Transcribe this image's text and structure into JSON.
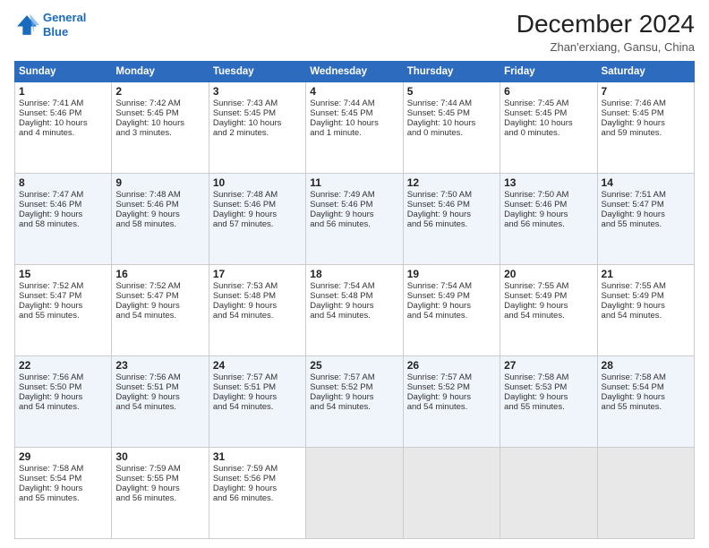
{
  "logo": {
    "line1": "General",
    "line2": "Blue"
  },
  "title": "December 2024",
  "subtitle": "Zhan'erxiang, Gansu, China",
  "days_header": [
    "Sunday",
    "Monday",
    "Tuesday",
    "Wednesday",
    "Thursday",
    "Friday",
    "Saturday"
  ],
  "weeks": [
    [
      {
        "day": "1",
        "lines": [
          "Sunrise: 7:41 AM",
          "Sunset: 5:46 PM",
          "Daylight: 10 hours",
          "and 4 minutes."
        ]
      },
      {
        "day": "2",
        "lines": [
          "Sunrise: 7:42 AM",
          "Sunset: 5:45 PM",
          "Daylight: 10 hours",
          "and 3 minutes."
        ]
      },
      {
        "day": "3",
        "lines": [
          "Sunrise: 7:43 AM",
          "Sunset: 5:45 PM",
          "Daylight: 10 hours",
          "and 2 minutes."
        ]
      },
      {
        "day": "4",
        "lines": [
          "Sunrise: 7:44 AM",
          "Sunset: 5:45 PM",
          "Daylight: 10 hours",
          "and 1 minute."
        ]
      },
      {
        "day": "5",
        "lines": [
          "Sunrise: 7:44 AM",
          "Sunset: 5:45 PM",
          "Daylight: 10 hours",
          "and 0 minutes."
        ]
      },
      {
        "day": "6",
        "lines": [
          "Sunrise: 7:45 AM",
          "Sunset: 5:45 PM",
          "Daylight: 10 hours",
          "and 0 minutes."
        ]
      },
      {
        "day": "7",
        "lines": [
          "Sunrise: 7:46 AM",
          "Sunset: 5:45 PM",
          "Daylight: 9 hours",
          "and 59 minutes."
        ]
      }
    ],
    [
      {
        "day": "8",
        "lines": [
          "Sunrise: 7:47 AM",
          "Sunset: 5:46 PM",
          "Daylight: 9 hours",
          "and 58 minutes."
        ]
      },
      {
        "day": "9",
        "lines": [
          "Sunrise: 7:48 AM",
          "Sunset: 5:46 PM",
          "Daylight: 9 hours",
          "and 58 minutes."
        ]
      },
      {
        "day": "10",
        "lines": [
          "Sunrise: 7:48 AM",
          "Sunset: 5:46 PM",
          "Daylight: 9 hours",
          "and 57 minutes."
        ]
      },
      {
        "day": "11",
        "lines": [
          "Sunrise: 7:49 AM",
          "Sunset: 5:46 PM",
          "Daylight: 9 hours",
          "and 56 minutes."
        ]
      },
      {
        "day": "12",
        "lines": [
          "Sunrise: 7:50 AM",
          "Sunset: 5:46 PM",
          "Daylight: 9 hours",
          "and 56 minutes."
        ]
      },
      {
        "day": "13",
        "lines": [
          "Sunrise: 7:50 AM",
          "Sunset: 5:46 PM",
          "Daylight: 9 hours",
          "and 56 minutes."
        ]
      },
      {
        "day": "14",
        "lines": [
          "Sunrise: 7:51 AM",
          "Sunset: 5:47 PM",
          "Daylight: 9 hours",
          "and 55 minutes."
        ]
      }
    ],
    [
      {
        "day": "15",
        "lines": [
          "Sunrise: 7:52 AM",
          "Sunset: 5:47 PM",
          "Daylight: 9 hours",
          "and 55 minutes."
        ]
      },
      {
        "day": "16",
        "lines": [
          "Sunrise: 7:52 AM",
          "Sunset: 5:47 PM",
          "Daylight: 9 hours",
          "and 54 minutes."
        ]
      },
      {
        "day": "17",
        "lines": [
          "Sunrise: 7:53 AM",
          "Sunset: 5:48 PM",
          "Daylight: 9 hours",
          "and 54 minutes."
        ]
      },
      {
        "day": "18",
        "lines": [
          "Sunrise: 7:54 AM",
          "Sunset: 5:48 PM",
          "Daylight: 9 hours",
          "and 54 minutes."
        ]
      },
      {
        "day": "19",
        "lines": [
          "Sunrise: 7:54 AM",
          "Sunset: 5:49 PM",
          "Daylight: 9 hours",
          "and 54 minutes."
        ]
      },
      {
        "day": "20",
        "lines": [
          "Sunrise: 7:55 AM",
          "Sunset: 5:49 PM",
          "Daylight: 9 hours",
          "and 54 minutes."
        ]
      },
      {
        "day": "21",
        "lines": [
          "Sunrise: 7:55 AM",
          "Sunset: 5:49 PM",
          "Daylight: 9 hours",
          "and 54 minutes."
        ]
      }
    ],
    [
      {
        "day": "22",
        "lines": [
          "Sunrise: 7:56 AM",
          "Sunset: 5:50 PM",
          "Daylight: 9 hours",
          "and 54 minutes."
        ]
      },
      {
        "day": "23",
        "lines": [
          "Sunrise: 7:56 AM",
          "Sunset: 5:51 PM",
          "Daylight: 9 hours",
          "and 54 minutes."
        ]
      },
      {
        "day": "24",
        "lines": [
          "Sunrise: 7:57 AM",
          "Sunset: 5:51 PM",
          "Daylight: 9 hours",
          "and 54 minutes."
        ]
      },
      {
        "day": "25",
        "lines": [
          "Sunrise: 7:57 AM",
          "Sunset: 5:52 PM",
          "Daylight: 9 hours",
          "and 54 minutes."
        ]
      },
      {
        "day": "26",
        "lines": [
          "Sunrise: 7:57 AM",
          "Sunset: 5:52 PM",
          "Daylight: 9 hours",
          "and 54 minutes."
        ]
      },
      {
        "day": "27",
        "lines": [
          "Sunrise: 7:58 AM",
          "Sunset: 5:53 PM",
          "Daylight: 9 hours",
          "and 55 minutes."
        ]
      },
      {
        "day": "28",
        "lines": [
          "Sunrise: 7:58 AM",
          "Sunset: 5:54 PM",
          "Daylight: 9 hours",
          "and 55 minutes."
        ]
      }
    ],
    [
      {
        "day": "29",
        "lines": [
          "Sunrise: 7:58 AM",
          "Sunset: 5:54 PM",
          "Daylight: 9 hours",
          "and 55 minutes."
        ]
      },
      {
        "day": "30",
        "lines": [
          "Sunrise: 7:59 AM",
          "Sunset: 5:55 PM",
          "Daylight: 9 hours",
          "and 56 minutes."
        ]
      },
      {
        "day": "31",
        "lines": [
          "Sunrise: 7:59 AM",
          "Sunset: 5:56 PM",
          "Daylight: 9 hours",
          "and 56 minutes."
        ]
      },
      null,
      null,
      null,
      null
    ]
  ]
}
